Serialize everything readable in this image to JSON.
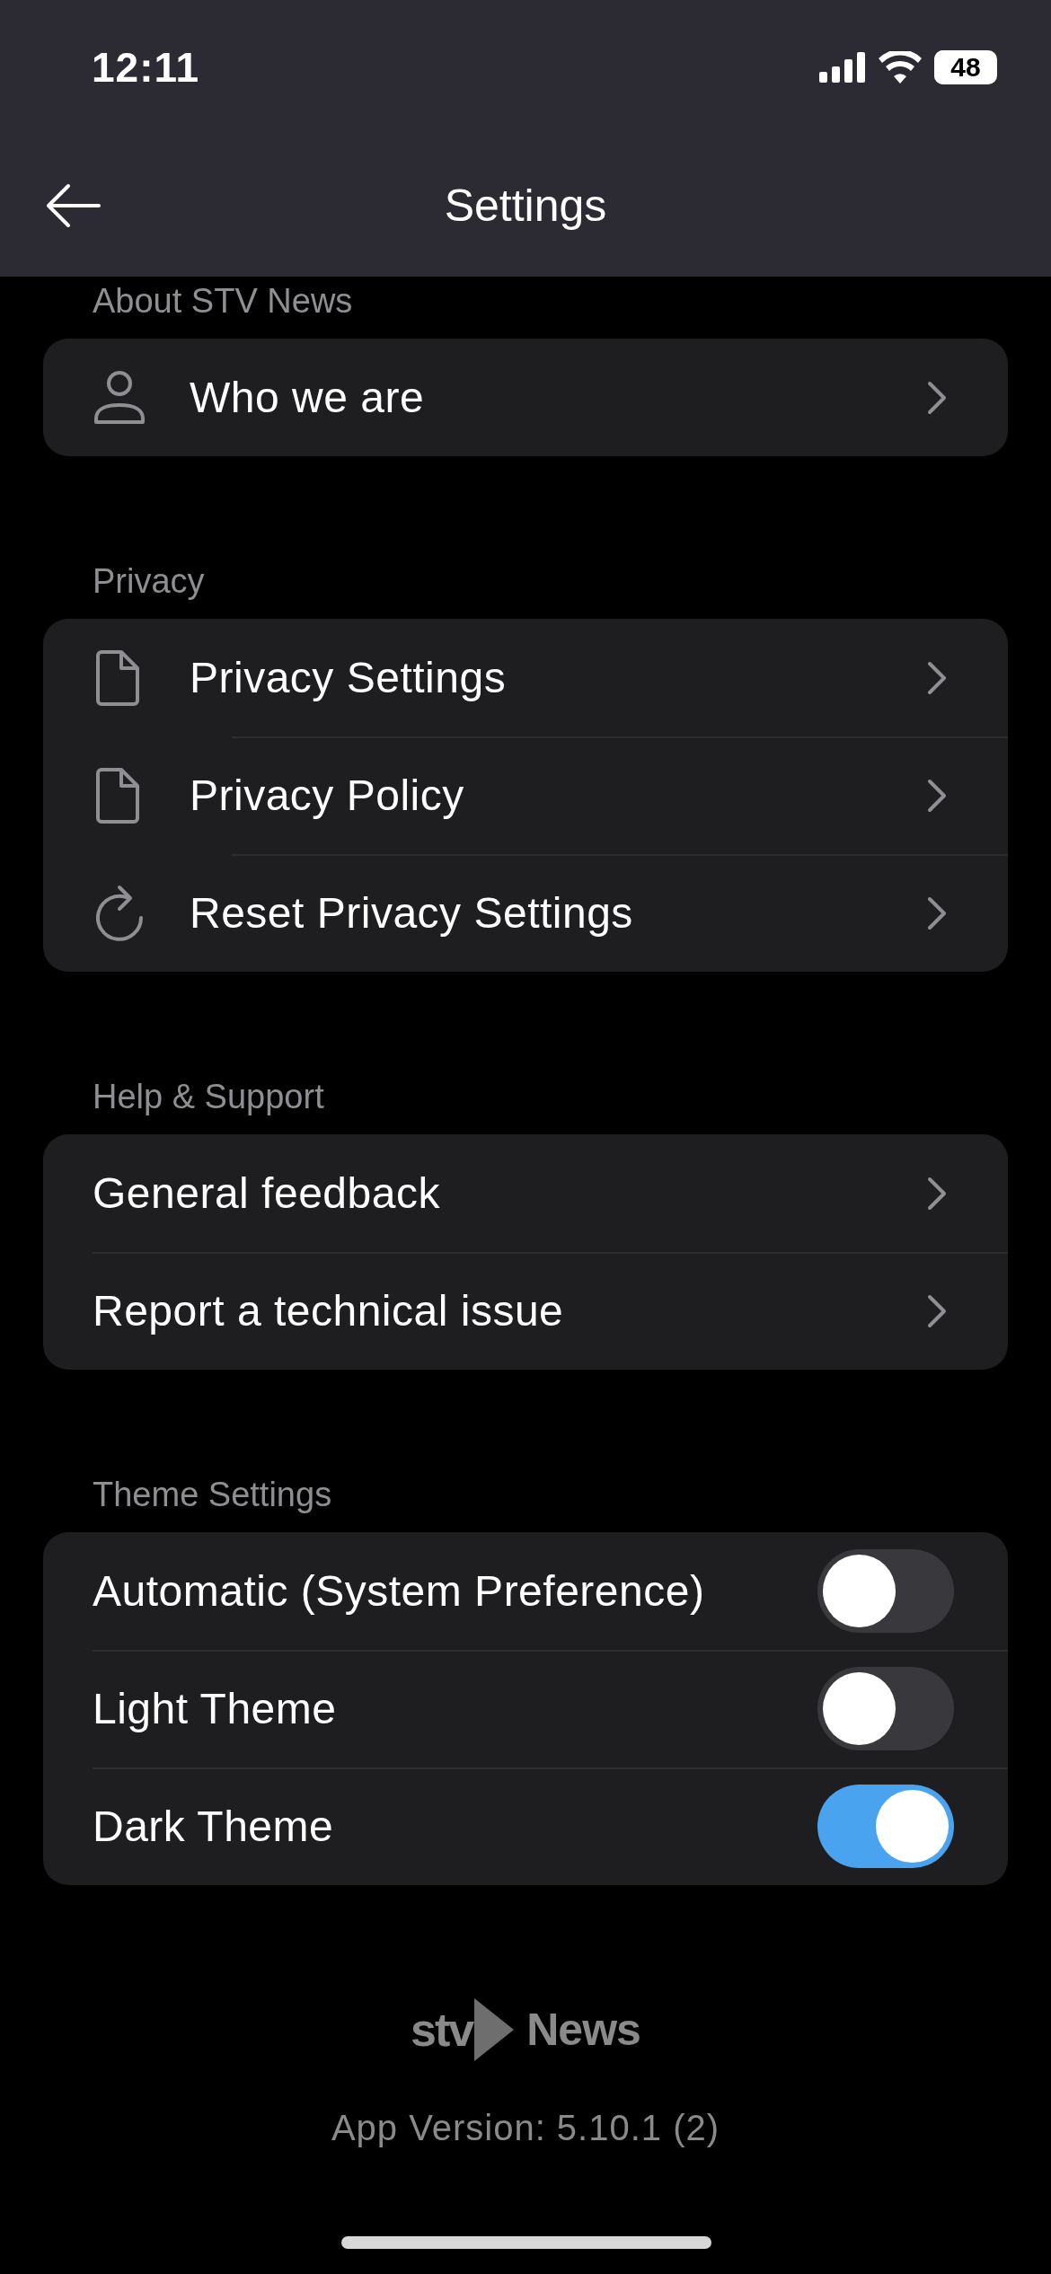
{
  "status_bar": {
    "time": "12:11",
    "battery": "48"
  },
  "nav": {
    "title": "Settings"
  },
  "sections": [
    {
      "title": "About STV News",
      "rows": [
        {
          "kind": "person-link",
          "label": "Who we are"
        }
      ]
    },
    {
      "title": "Privacy",
      "rows": [
        {
          "kind": "document-link",
          "label": "Privacy Settings"
        },
        {
          "kind": "document-link",
          "label": "Privacy Policy"
        },
        {
          "kind": "refresh-link",
          "label": "Reset Privacy Settings"
        }
      ]
    },
    {
      "title": "Help & Support",
      "rows": [
        {
          "kind": "link",
          "label": "General feedback"
        },
        {
          "kind": "link",
          "label": "Report a technical issue"
        }
      ]
    },
    {
      "title": "Theme Settings",
      "rows": [
        {
          "kind": "toggle",
          "label": "Automatic (System Preference)",
          "on": false
        },
        {
          "kind": "toggle",
          "label": "Light Theme",
          "on": false
        },
        {
          "kind": "toggle",
          "label": "Dark Theme",
          "on": true
        }
      ]
    }
  ],
  "footer": {
    "logo_mark": "stv",
    "logo_word": "News",
    "version": "App Version: 5.10.1 (2)"
  }
}
